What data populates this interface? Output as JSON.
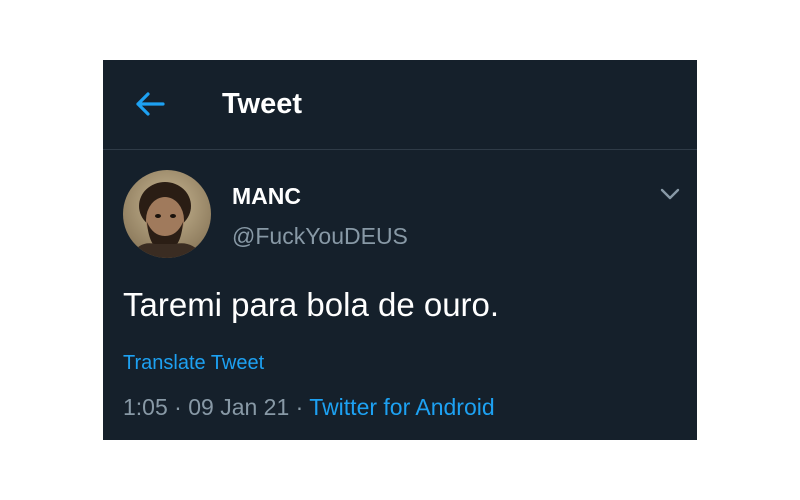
{
  "header": {
    "title": "Tweet",
    "back_icon": "arrow-left-icon"
  },
  "author": {
    "display_name": "MANC",
    "username": "@FuckYouDEUS",
    "avatar_icon": "user-avatar"
  },
  "tweet": {
    "text": "Taremi para bola de ouro.",
    "translate_label": "Translate Tweet",
    "time": "1:05",
    "separator": "·",
    "date": "09 Jan 21",
    "source": "Twitter for Android",
    "more_icon": "chevron-down-icon"
  },
  "colors": {
    "background": "#15202b",
    "accent": "#1da1f2",
    "secondary_text": "#8899a6",
    "primary_text": "#ffffff"
  }
}
